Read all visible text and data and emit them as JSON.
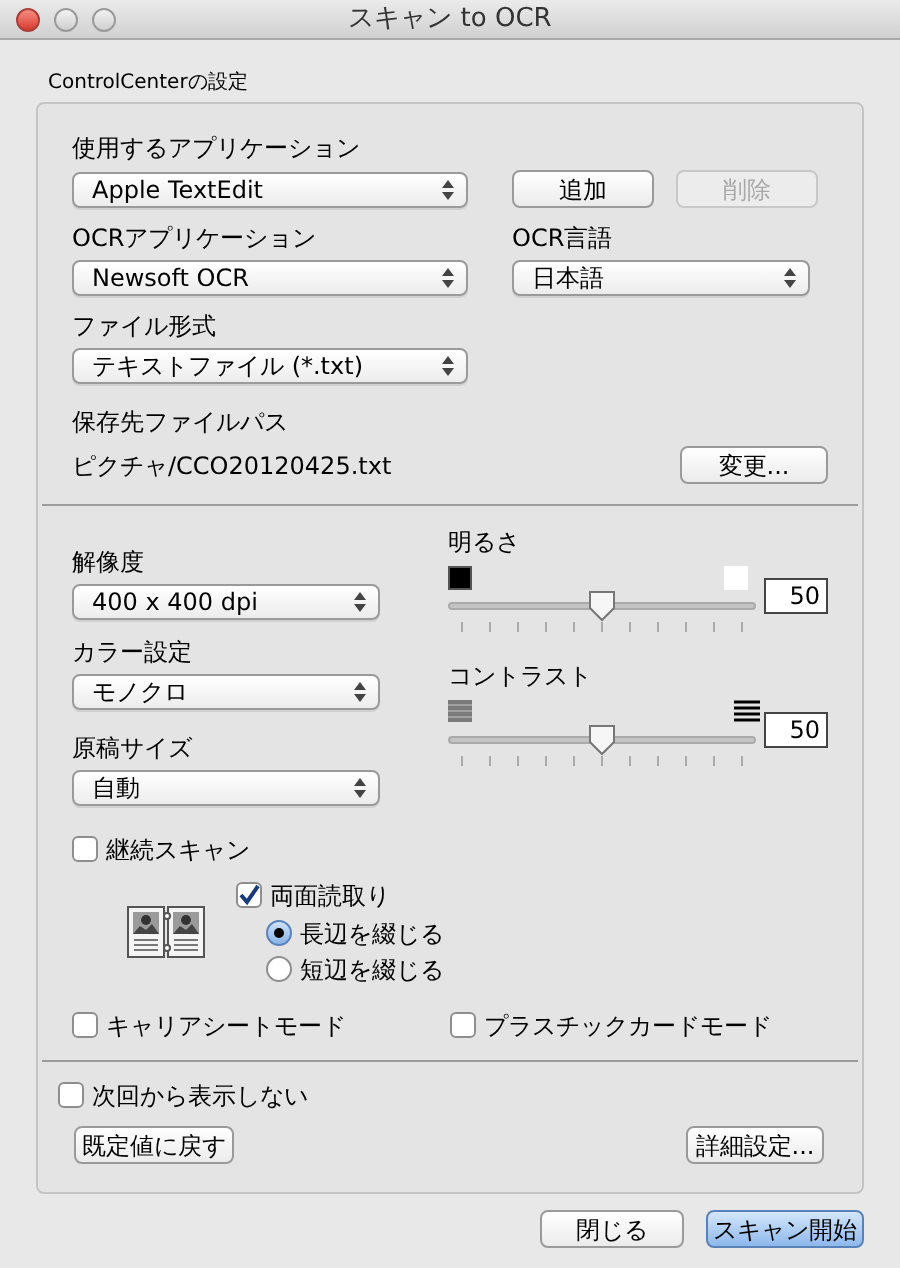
{
  "window": {
    "title": "スキャン to OCR"
  },
  "group": {
    "title": "ControlCenterの設定"
  },
  "application": {
    "label": "使用するアプリケーション",
    "value": "Apple TextEdit"
  },
  "app_buttons": [
    {
      "label": "追加",
      "disabled": false
    },
    {
      "label": "削除",
      "disabled": true
    }
  ],
  "ocr_application": {
    "label": "OCRアプリケーション",
    "value": "Newsoft OCR"
  },
  "ocr_language": {
    "label": "OCR言語",
    "value": "日本語"
  },
  "file_format": {
    "label": "ファイル形式",
    "value": "テキストファイル (*.txt)"
  },
  "save_path": {
    "label": "保存先ファイルパス",
    "value": "ピクチャ/CCO20120425.txt",
    "button": "変更..."
  },
  "resolution": {
    "label": "解像度",
    "value": "400 x 400 dpi"
  },
  "color": {
    "label": "カラー設定",
    "value": "モノクロ"
  },
  "document_size": {
    "label": "原稿サイズ",
    "value": "自動"
  },
  "sliders": [
    {
      "kind": "brightness",
      "label": "明るさ",
      "level": 0.5,
      "reading": "50"
    },
    {
      "kind": "contrast",
      "label": "コントラスト",
      "level": 0.5,
      "reading": "50"
    }
  ],
  "continuous_scan": {
    "label": "継続スキャン",
    "checked": false
  },
  "duplex": {
    "label": "両面読取り",
    "checked": true,
    "options": [
      {
        "label": "長辺を綴じる",
        "selected": true
      },
      {
        "label": "短辺を綴じる",
        "selected": false
      }
    ]
  },
  "modes": [
    {
      "label": "キャリアシートモード",
      "checked": false
    },
    {
      "label": "プラスチックカードモード",
      "checked": false
    }
  ],
  "dont_show": {
    "label": "次回から表示しない",
    "checked": false
  },
  "defaults_button": "既定値に戻す",
  "advanced_button": "詳細設定...",
  "footer_buttons": [
    {
      "label": "閉じる",
      "primary": false
    },
    {
      "label": "スキャン開始",
      "primary": true
    }
  ]
}
